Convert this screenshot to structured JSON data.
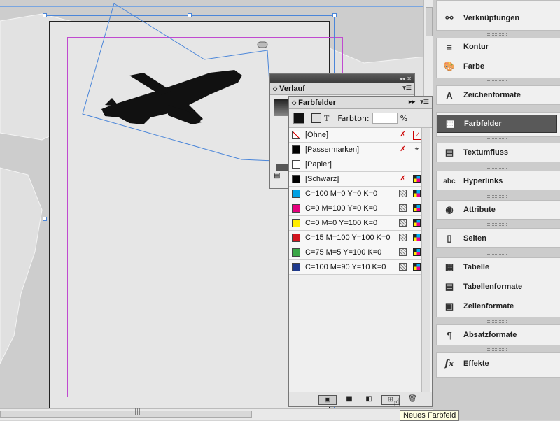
{
  "dock": {
    "items": [
      {
        "label": "Verknüpfungen",
        "icon": "links-icon"
      },
      {
        "label": "Kontur",
        "icon": "stroke-icon"
      },
      {
        "label": "Farbe",
        "icon": "palette-icon"
      },
      {
        "label": "Zeichenformate",
        "icon": "character-styles-icon"
      },
      {
        "label": "Farbfelder",
        "icon": "swatches-icon"
      },
      {
        "label": "Textumfluss",
        "icon": "text-wrap-icon"
      },
      {
        "label": "Hyperlinks",
        "icon": "hyperlinks-icon"
      },
      {
        "label": "Attribute",
        "icon": "attributes-icon"
      },
      {
        "label": "Seiten",
        "icon": "pages-icon"
      },
      {
        "label": "Tabelle",
        "icon": "table-icon"
      },
      {
        "label": "Tabellenformate",
        "icon": "table-styles-icon"
      },
      {
        "label": "Zellenformate",
        "icon": "cell-styles-icon"
      },
      {
        "label": "Absatzformate",
        "icon": "paragraph-styles-icon"
      },
      {
        "label": "Effekte",
        "icon": "effects-icon"
      }
    ],
    "active": "Farbfelder"
  },
  "verlauf_panel": {
    "title": "Verlauf"
  },
  "farbfelder_panel": {
    "title": "Farbfelder",
    "tint_label": "Farbton:",
    "tint_value": "",
    "tint_unit": "%",
    "swatches": [
      {
        "name": "[Ohne]",
        "color": "none"
      },
      {
        "name": "[Passermarken]",
        "color": "#000000"
      },
      {
        "name": "[Papier]",
        "color": "#ffffff"
      },
      {
        "name": "[Schwarz]",
        "color": "#000000"
      },
      {
        "name": "C=100 M=0 Y=0 K=0",
        "color": "#00a0e3"
      },
      {
        "name": "C=0 M=100 Y=0 K=0",
        "color": "#e4007d"
      },
      {
        "name": "C=0 M=0 Y=100 K=0",
        "color": "#ffed00"
      },
      {
        "name": "C=15 M=100 Y=100 K=0",
        "color": "#d2141e"
      },
      {
        "name": "C=75 M=5 Y=100 K=0",
        "color": "#3aa646"
      },
      {
        "name": "C=100 M=90 Y=10 K=0",
        "color": "#1f3a8c"
      }
    ]
  },
  "tooltip": {
    "text": "Neues Farbfeld"
  },
  "colors": {
    "frame_blue": "#4b86d9",
    "margin_magenta": "#c04ad0",
    "map_land": "#e4e4e4",
    "map_sea": "#cdcdcd"
  }
}
